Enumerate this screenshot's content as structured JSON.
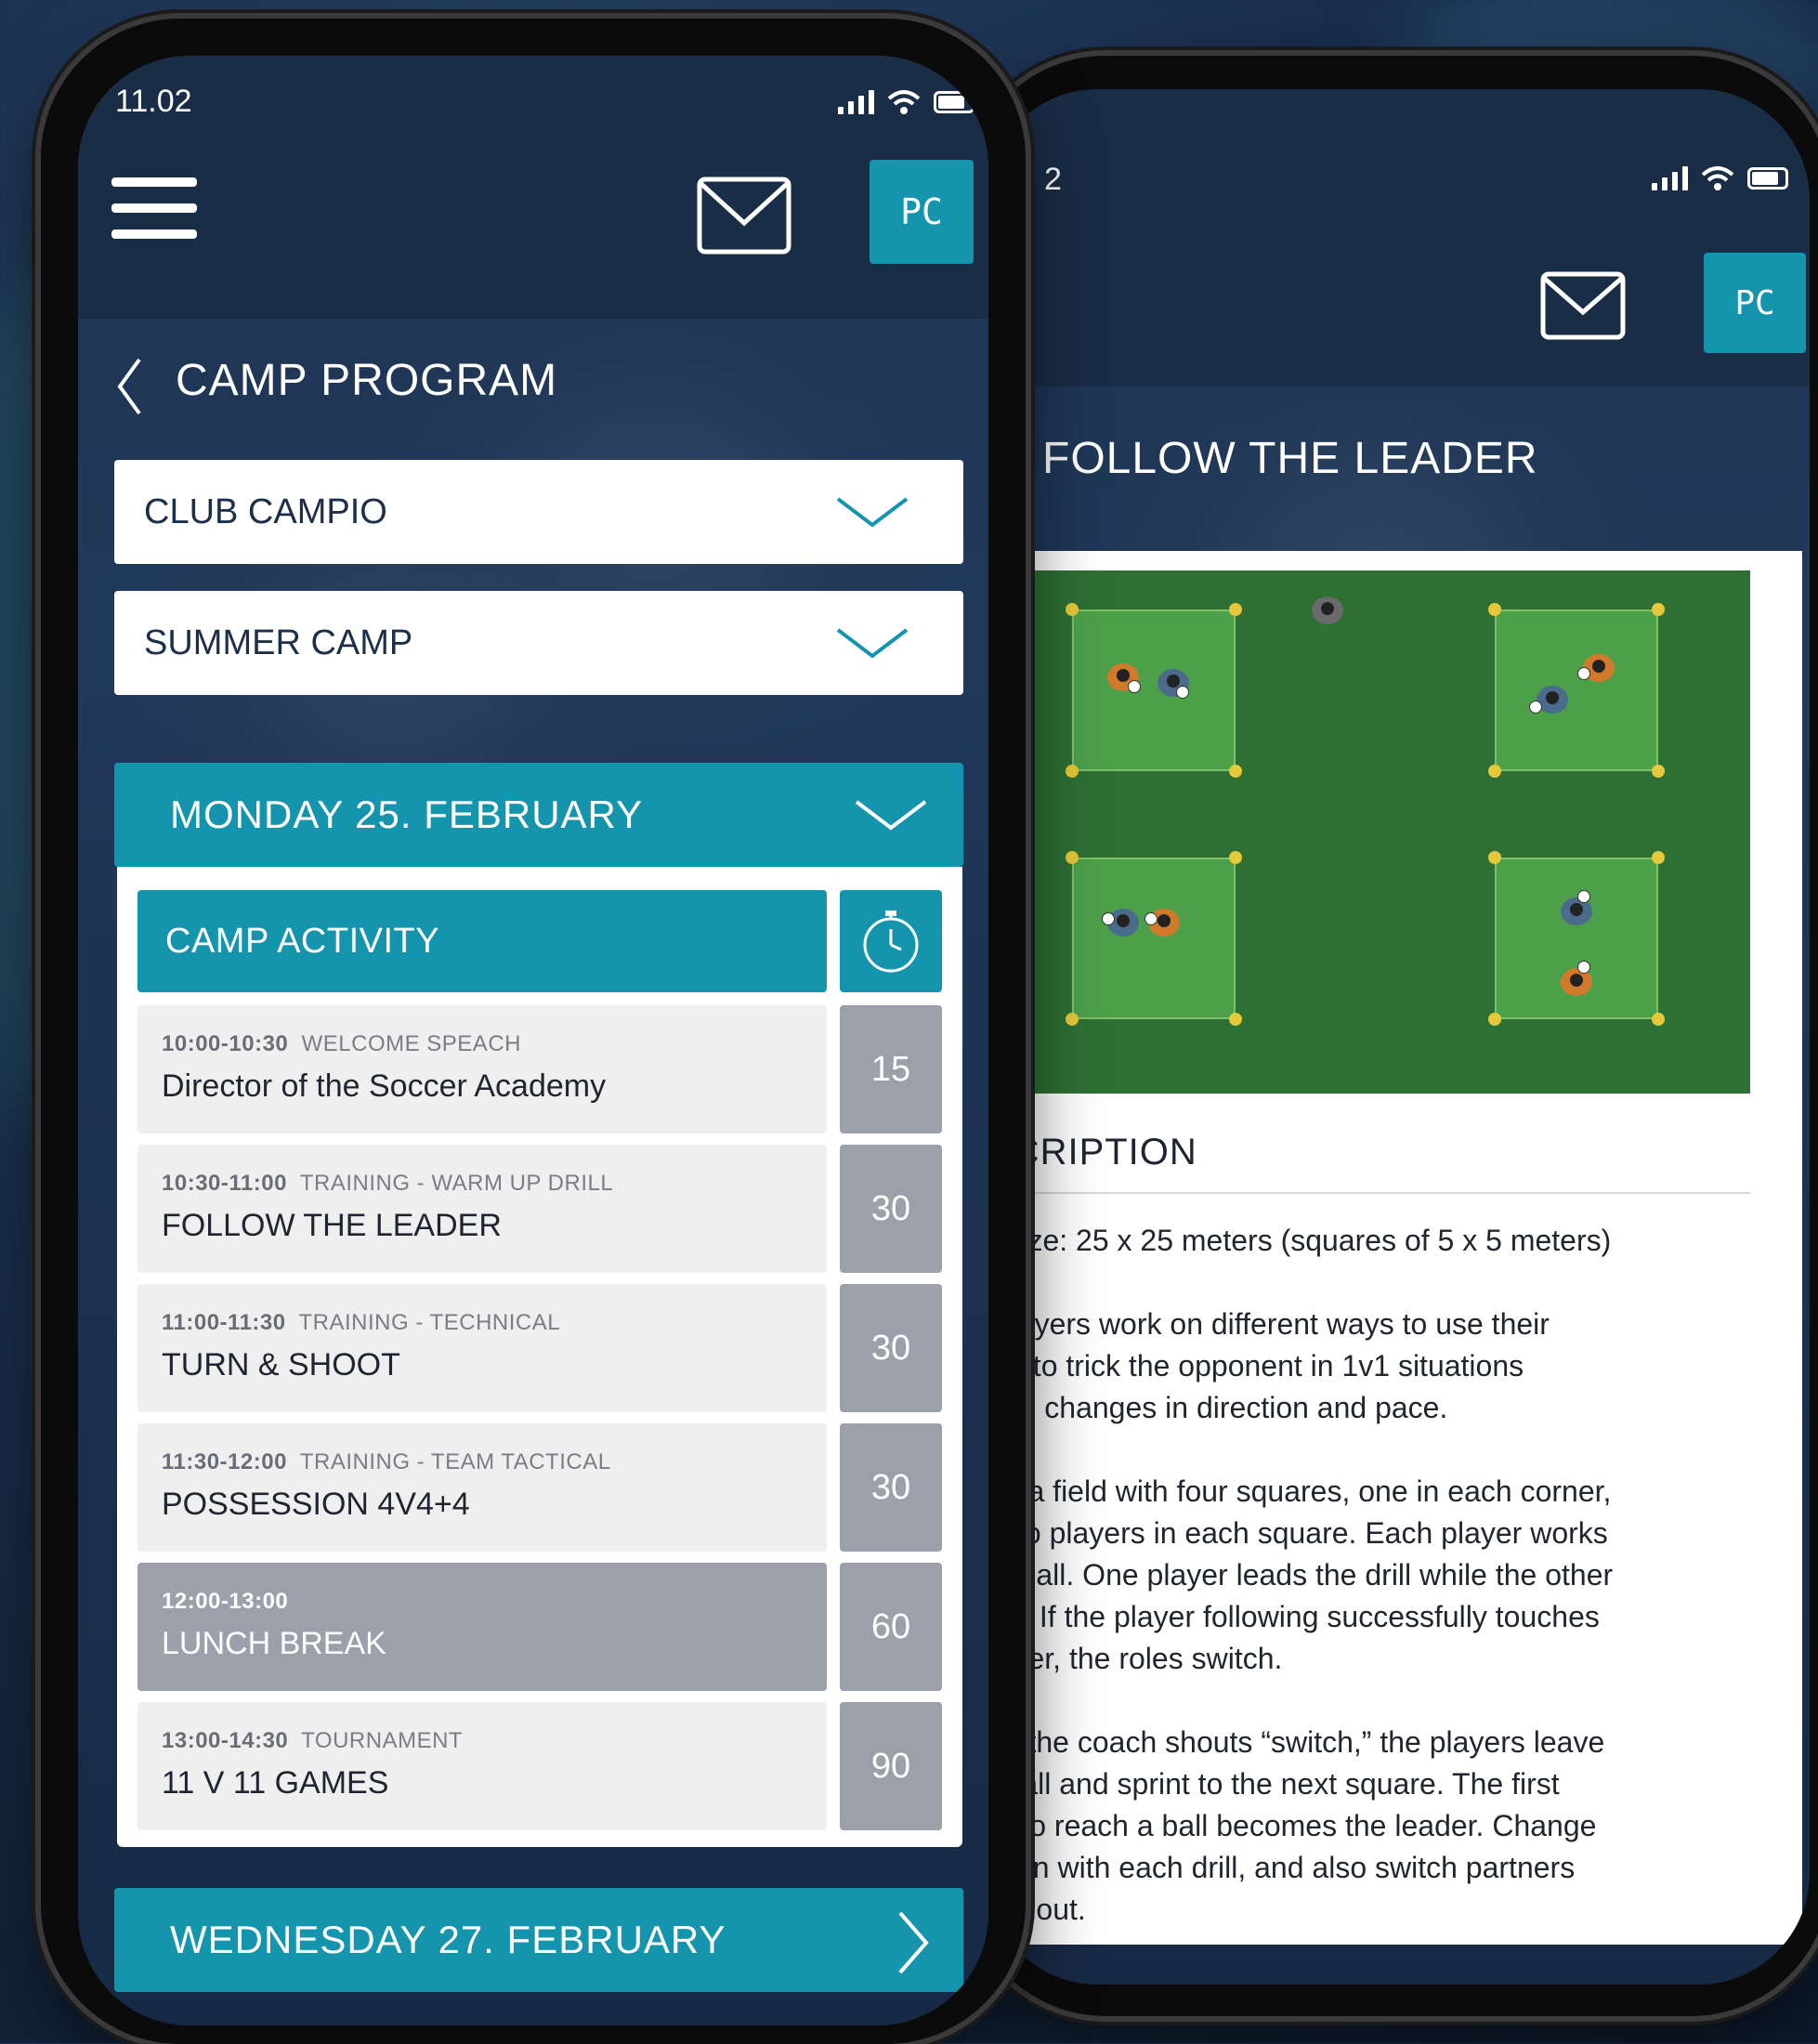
{
  "colors": {
    "accent": "#1594ad",
    "navy": "#1a2d47",
    "grey": "#9ca0ab",
    "pitch": "#2e7034",
    "square": "#4da04a"
  },
  "front": {
    "status": {
      "time": "11.02"
    },
    "header": {
      "menu_icon": "hamburger-icon",
      "mail_icon": "envelope-icon",
      "avatar": "PC"
    },
    "page": {
      "back_icon": "chevron-left-icon",
      "title": "CAMP PROGRAM"
    },
    "filters": [
      {
        "value": "CLUB CAMPIO"
      },
      {
        "value": "SUMMER CAMP"
      }
    ],
    "day": {
      "label": "MONDAY 25. FEBRUARY",
      "activity_header": "CAMP ACTIVITY",
      "timer_icon": "stopwatch-icon",
      "activities": [
        {
          "time": "10:00-10:30",
          "category": "WELCOME SPEACH",
          "title": "Director of  the Soccer Academy",
          "duration": "15"
        },
        {
          "time": "10:30-11:00",
          "category": "TRAINING - WARM UP DRILL",
          "title": "FOLLOW THE LEADER",
          "duration": "30"
        },
        {
          "time": "11:00-11:30",
          "category": "TRAINING - TECHNICAL",
          "title": "TURN & SHOOT",
          "duration": "30"
        },
        {
          "time": "11:30-12:00",
          "category": "TRAINING - TEAM TACTICAL",
          "title": "POSSESSION 4V4+4",
          "duration": "30"
        },
        {
          "time": "12:00-13:00",
          "category": "",
          "title": "LUNCH BREAK",
          "duration": "60"
        },
        {
          "time": "13:00-14:30",
          "category": "TOURNAMENT",
          "title": "11 V 11 GAMES",
          "duration": "90"
        }
      ]
    },
    "next_day": {
      "label": "WEDNESDAY 27. FEBRUARY",
      "icon": "chevron-right-icon"
    }
  },
  "back": {
    "status": {
      "time_fragment": "2"
    },
    "header": {
      "mail_icon": "envelope-icon",
      "avatar": "PC"
    },
    "title": "FOLLOW THE LEADER",
    "description_heading": "SCRIPTION",
    "description": [
      "l Size: 25 x 25 meters (squares of 5 x 5 meters)",
      " players work on different ways to use their\nies to trick the opponent in 1v1 situations\nugh changes in direction and pace.",
      "up a field with four squares, one in each corner,\n two players in each square. Each player works\n a ball. One player leads the drill while the other\nws. If the player following successfully touches\nother, the roles switch.",
      "en the coach shouts “switch,” the players leave\nr ball and sprint to the next square. The first\ner to reach a ball becomes the leader. Change\nction with each drill, and also switch partners\nughout."
    ]
  }
}
